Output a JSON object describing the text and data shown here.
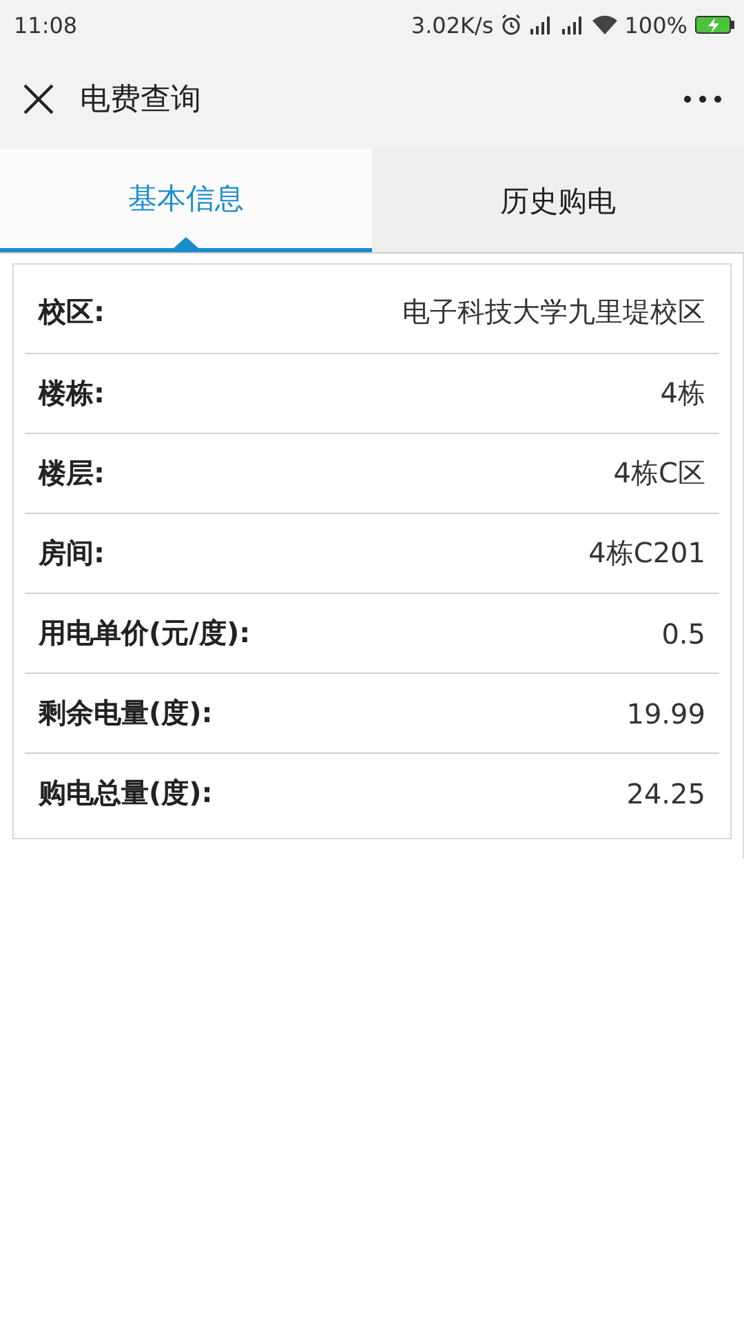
{
  "status_bar": {
    "time": "11:08",
    "speed": "3.02K/s",
    "battery_text": "100%"
  },
  "header": {
    "title": "电费查询"
  },
  "tabs": [
    {
      "label": "基本信息",
      "selected": true
    },
    {
      "label": "历史购电",
      "selected": false
    }
  ],
  "info_rows": [
    {
      "label": "校区:",
      "value": "电子科技大学九里堤校区"
    },
    {
      "label": "楼栋:",
      "value": "4栋"
    },
    {
      "label": "楼层:",
      "value": "4栋C区"
    },
    {
      "label": "房间:",
      "value": "4栋C201"
    },
    {
      "label": "用电单价(元/度):",
      "value": "0.5"
    },
    {
      "label": "剩余电量(度):",
      "value": "19.99"
    },
    {
      "label": "购电总量(度):",
      "value": "24.25"
    }
  ]
}
